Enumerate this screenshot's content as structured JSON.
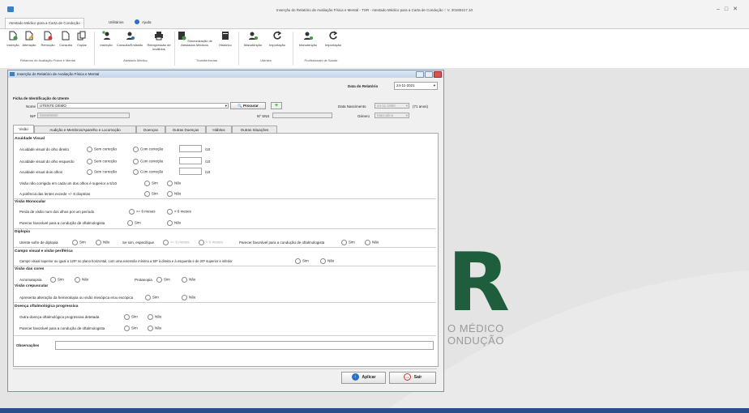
{
  "window": {
    "title": "Inserção do Relatório de Avaliação Física e Mental - TSR - Atestado Médico para a Carta de Condução :: V. 20180417.10"
  },
  "ribbon_tabs": [
    "Atestado Médico para a Carta de Condução",
    "Utilitários",
    "Ajuda"
  ],
  "ribbon_buttons": [
    {
      "label": "Inserção",
      "icon": "add-document-icon"
    },
    {
      "label": "Alteração",
      "icon": "edit-document-icon"
    },
    {
      "label": "Remoção",
      "icon": "remove-document-icon"
    },
    {
      "label": "Consulta",
      "icon": "view-document-icon"
    },
    {
      "label": "Copiar",
      "icon": "copy-document-icon"
    },
    {
      "label": "Inserção",
      "icon": "add-doctor-icon"
    },
    {
      "label": "Consulta/Emissão",
      "icon": "doctor-info-icon"
    },
    {
      "label": "Reimpressão de inválidos",
      "icon": "printer-icon"
    },
    {
      "label": "Sincronização de Atestados Médicos",
      "icon": "sync-server-icon"
    },
    {
      "label": "Histórico",
      "icon": "history-server-icon"
    },
    {
      "label": "Manutenção",
      "icon": "user-maintenance-icon"
    },
    {
      "label": "Importação",
      "icon": "import-arrow-icon"
    },
    {
      "label": "Manutenção",
      "icon": "professional-maintenance-icon"
    },
    {
      "label": "Importação",
      "icon": "import-arrow-icon"
    }
  ],
  "ribbon_groups": [
    "Relatório de Avaliação Física e Mental",
    "Atestado Médico",
    "Transferências",
    "Utentes",
    "Profissionais de Saúde"
  ],
  "background_logo": {
    "letter": "R",
    "line1": "O MÉDICO",
    "line2": "ONDUÇÃO"
  },
  "dialog": {
    "title": "Inserção do Relatório de Avaliação Física e Mental",
    "data_relatorio_label": "Data do Relatório",
    "data_relatorio_value": "24-11-2021",
    "ficha_title": "Ficha de Identificação do Utente",
    "nome_label": "Nome",
    "nome_value": "UTENTE DEMO",
    "procurar_label": "Procurar",
    "nif_label": "NIF",
    "nif_value": "999999990",
    "nsns_label": "Nº SNS",
    "nsns_value": "",
    "data_nasc_label": "Data Nascimento",
    "data_nasc_value": "24-11-1950",
    "idade": "(71 anos)",
    "genero_label": "Género",
    "genero_value": "Masculino",
    "tabs": [
      "Visão",
      "Audição e Membros/Aparelho e Locomoção",
      "Doenças",
      "Outras Doenças",
      "Hábitos",
      "Outras Situações"
    ],
    "acuidade": {
      "title": "Acuidade Visual",
      "rows": [
        {
          "label": "Acuidade visual do olho direito",
          "opt1": "Sem correção",
          "opt2": "Com correção",
          "unit": "/10"
        },
        {
          "label": "Acuidade visual do olho esquerdo",
          "opt1": "Sem correção",
          "opt2": "Com correção",
          "unit": "/10"
        },
        {
          "label": "Acuidade visual dois olhos",
          "opt1": "Sem correção",
          "opt2": "Com correção",
          "unit": "/10"
        }
      ],
      "q1": "Visão não corrigida em cada um dos olhos é superior a 5/10",
      "q2": "A potência das lentes excede +/- 8 dioptrias"
    },
    "sim": "Sim",
    "nao": "Não",
    "monocular": {
      "title": "Visão Monocular",
      "q1": "Perda de visão num dos olhos por um período",
      "o1": ">= 6 meses",
      "o2": "< 6 meses",
      "q2": "Parecer favorável para a condução de oftalmologista"
    },
    "diplopia": {
      "title": "Diplopia",
      "q1": "Utente sofre de diplopia",
      "q2": "Se sim, especifique",
      "o1": ">= 6 meses",
      "o2": "< 6 meses",
      "q3": "Parecer favorável para a condução de oftalmologista"
    },
    "campo": {
      "title": "Campo visual e visão periférica",
      "q1": "Campo visual superior ou igual a 120º no plano horizontal, com uma extensão mínima a 50º à direita e à esquerda e de 20º superior e inferior"
    },
    "cores": {
      "title": "Visão das cores",
      "q1": "Acromatopsia",
      "q2": "Protanopia"
    },
    "crepuscular": {
      "title": "Visão crepuscular",
      "q1": "Apresenta alteração da hemeralopia ou visão mesópica e/ou escópica"
    },
    "progressiva": {
      "title": "Doença oftalmológica progressiva",
      "q1": "Outra doença oftalmológica progressiva detetada",
      "q2": "Parecer favorável para a condução de oftalmologista"
    },
    "observacoes_label": "Observações",
    "aplicar": "Aplicar",
    "sair": "Sair"
  },
  "colors": {
    "accent": "#2b4d8a",
    "logo_green": "#1f5e3c",
    "ribbon_green": "#3a9d3a"
  }
}
